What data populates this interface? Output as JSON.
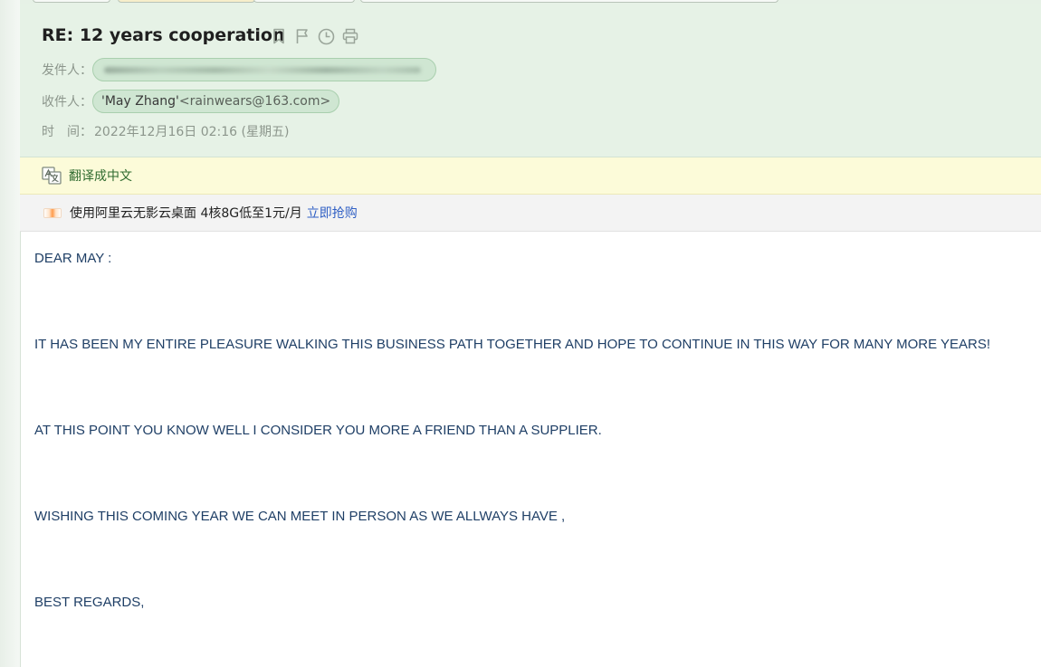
{
  "email": {
    "subject": "RE: 12 years cooperation",
    "from_label": "发件人：",
    "to_label": "收件人：",
    "to_name": "'May Zhang'",
    "to_addr": "<rainwears@163.com>",
    "time_label": "时　间：",
    "time_value": "2022年12月16日 02:16 (星期五)"
  },
  "header_icons": [
    "bookmark-icon",
    "flag-icon",
    "clock-icon",
    "print-icon"
  ],
  "translate": {
    "label": "翻译成中文"
  },
  "ad": {
    "text": "使用阿里云无影云桌面 4核8G低至1元/月",
    "link": "立即抢购"
  },
  "body": {
    "lines": [
      "DEAR MAY :",
      "IT HAS BEEN MY ENTIRE PLEASURE WALKING THIS BUSINESS PATH TOGETHER AND HOPE TO CONTINUE IN THIS WAY FOR MANY MORE YEARS!",
      "AT THIS POINT YOU KNOW WELL I CONSIDER YOU MORE A FRIEND THAN A SUPPLIER.",
      "WISHING THIS COMING YEAR WE CAN MEET IN PERSON AS WE ALLWAYS HAVE ,",
      "BEST REGARDS,"
    ]
  },
  "colors": {
    "header_bg": "#e6f2e6",
    "chip_bg": "#cfe6d2",
    "translate_bg": "#fcfbd9",
    "body_text": "#1f3f66",
    "link": "#2f5fc4"
  }
}
